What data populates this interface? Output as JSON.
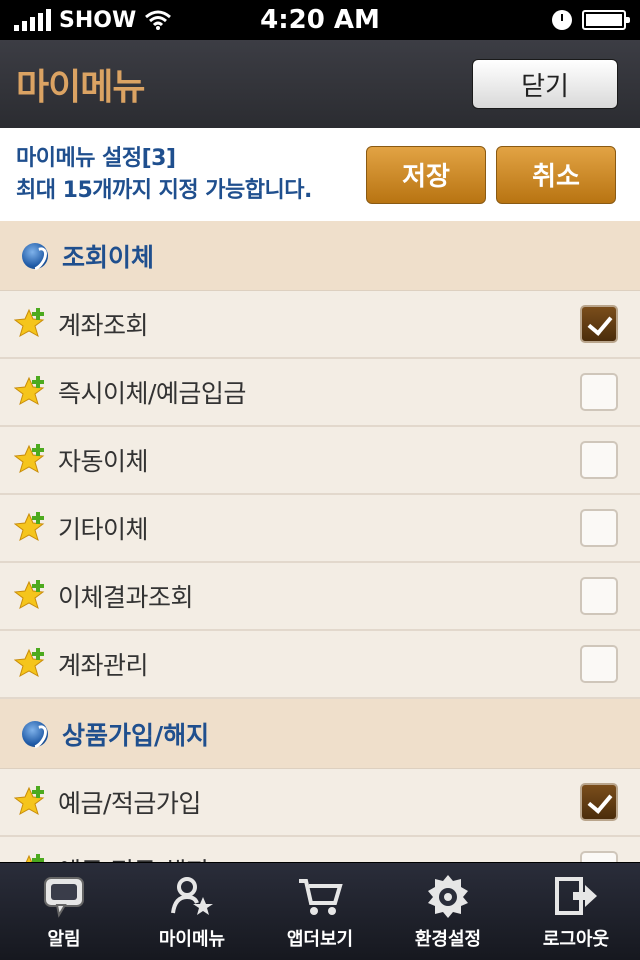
{
  "status_bar": {
    "carrier": "SHOW",
    "time": "4:20 AM"
  },
  "header": {
    "title": "마이메뉴",
    "close_label": "닫기"
  },
  "settings": {
    "line1": "마이메뉴 설정[3]",
    "line2": "최대 15개까지 지정 가능합니다.",
    "save_label": "저장",
    "cancel_label": "취소"
  },
  "sections": [
    {
      "title": "조회이체",
      "items": [
        {
          "label": "계좌조회",
          "checked": true
        },
        {
          "label": "즉시이체/예금입금",
          "checked": false
        },
        {
          "label": "자동이체",
          "checked": false
        },
        {
          "label": "기타이체",
          "checked": false
        },
        {
          "label": "이체결과조회",
          "checked": false
        },
        {
          "label": "계좌관리",
          "checked": false
        }
      ]
    },
    {
      "title": "상품가입/해지",
      "items": [
        {
          "label": "예금/적금가입",
          "checked": true
        },
        {
          "label": "예금/적금 해지",
          "checked": false
        }
      ]
    }
  ],
  "tabs": [
    {
      "label": "알림",
      "icon": "speech-bubble-icon"
    },
    {
      "label": "마이메뉴",
      "icon": "person-star-icon"
    },
    {
      "label": "앱더보기",
      "icon": "cart-icon"
    },
    {
      "label": "환경설정",
      "icon": "gear-icon"
    },
    {
      "label": "로그아웃",
      "icon": "logout-icon"
    }
  ],
  "colors": {
    "accent": "#dba363",
    "link_blue": "#1f4f8e",
    "button_gold": "#c98524"
  }
}
